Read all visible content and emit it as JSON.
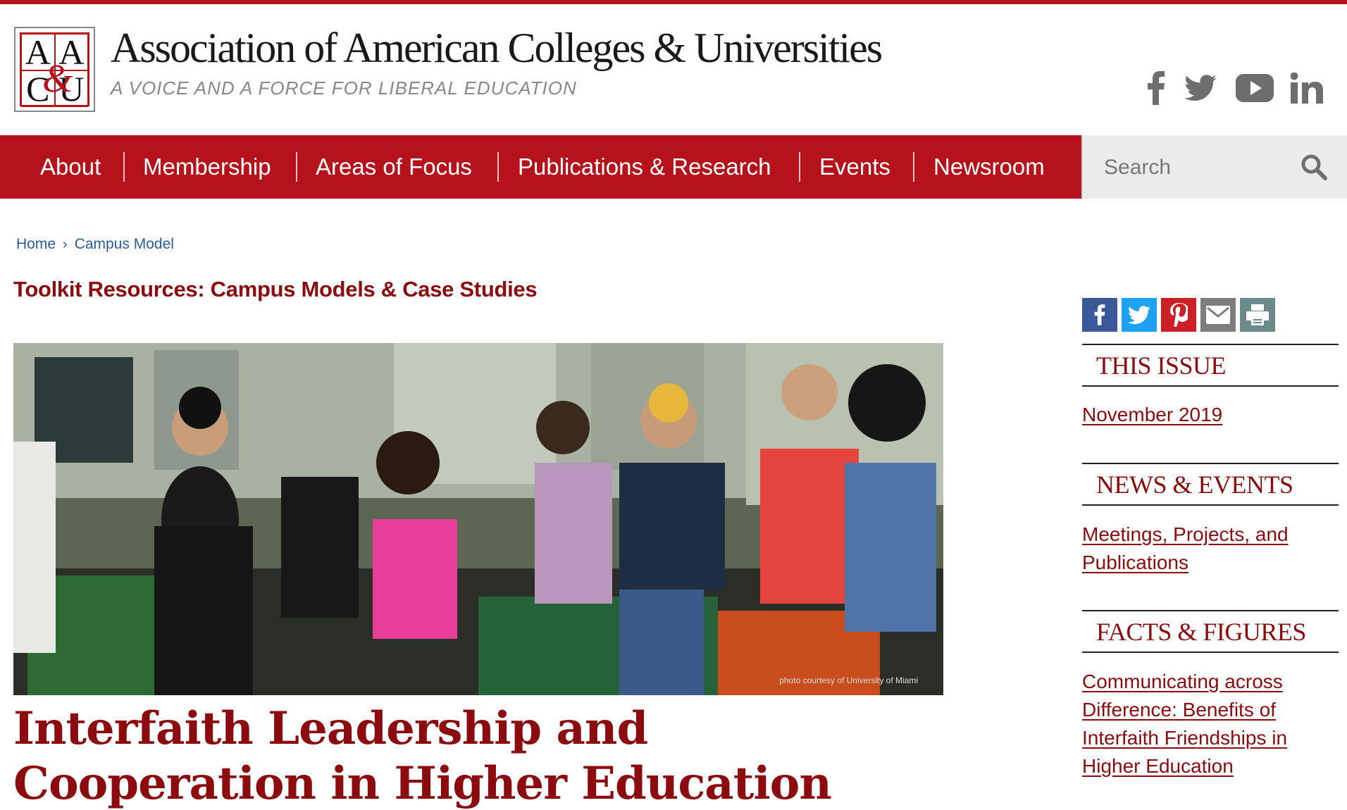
{
  "header": {
    "logo": {
      "cells": [
        "A",
        "A",
        "C",
        "U"
      ],
      "amp": "&"
    },
    "title": "Association of American Colleges & Universities",
    "tagline": "A VOICE AND A FORCE FOR LIBERAL EDUCATION",
    "social": [
      "facebook-icon",
      "twitter-icon",
      "youtube-icon",
      "linkedin-icon"
    ]
  },
  "nav": {
    "items": [
      {
        "label": "About"
      },
      {
        "label": "Membership"
      },
      {
        "label": "Areas of Focus"
      },
      {
        "label": "Publications & Research"
      },
      {
        "label": "Events"
      },
      {
        "label": "Newsroom"
      }
    ],
    "search": {
      "placeholder": "Search"
    }
  },
  "breadcrumb": {
    "items": [
      "Home",
      "Campus Model"
    ],
    "separator": "›"
  },
  "main": {
    "section_title": "Toolkit Resources: Campus Models & Case Studies",
    "image_credit": "photo courtesy of University of Miami",
    "article_title": "Interfaith Leadership and Cooperation in Higher Education"
  },
  "sidebar": {
    "share": [
      {
        "icon": "facebook-icon",
        "color": "#3b5998"
      },
      {
        "icon": "twitter-icon",
        "color": "#1da1f2"
      },
      {
        "icon": "pinterest-icon",
        "color": "#cb2027"
      },
      {
        "icon": "email-icon",
        "color": "#7d7d7d"
      },
      {
        "icon": "print-icon",
        "color": "#6d8a8a"
      }
    ],
    "sections": [
      {
        "heading": "THIS ISSUE",
        "link": "November 2019"
      },
      {
        "heading": "NEWS & EVENTS",
        "link": "Meetings, Projects, and Publications"
      },
      {
        "heading": "FACTS & FIGURES",
        "link": "Communicating across Difference: Benefits of Interfaith Friendships in Higher Education"
      }
    ]
  },
  "colors": {
    "brand_red": "#b5121b",
    "title_red": "#8b0b0f",
    "link_blue": "#2a5d9a"
  }
}
